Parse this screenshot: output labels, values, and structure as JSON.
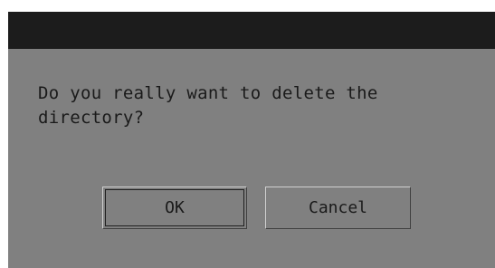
{
  "dialog": {
    "message": "Do you really want to delete the\ndirectory?",
    "ok_label": "OK",
    "cancel_label": "Cancel"
  },
  "colors": {
    "dialog_background": "#808080",
    "titlebar_background": "#1c1c1c",
    "text": "#1a1a1a"
  }
}
